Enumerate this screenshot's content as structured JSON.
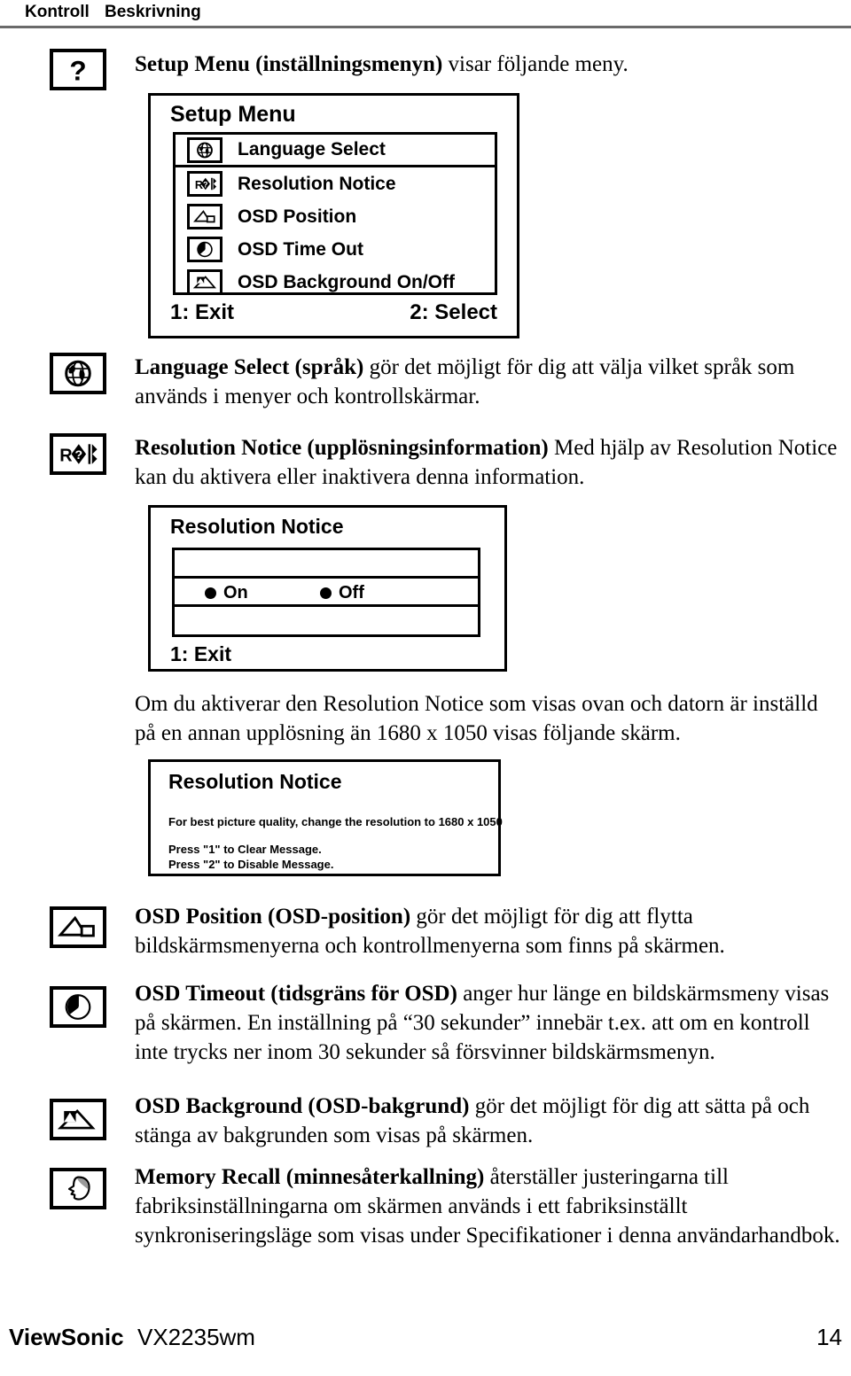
{
  "header": {
    "col1": "Kontroll",
    "col2": "Beskrivning"
  },
  "intro": {
    "text_bold": "Setup Menu (inställningsmenyn)",
    "text_rest": " visar följande meny."
  },
  "osd_setup": {
    "title": "Setup Menu",
    "items": [
      {
        "icon": "globe-icon",
        "label": "Language Select"
      },
      {
        "icon": "resolution-icon",
        "label": "Resolution Notice"
      },
      {
        "icon": "osd-position-icon",
        "label": "OSD Position"
      },
      {
        "icon": "osd-timeout-icon",
        "label": "OSD Time Out"
      },
      {
        "icon": "osd-background-icon",
        "label": "OSD Background On/Off"
      }
    ],
    "footer_left": "1: Exit",
    "footer_right": "2: Select"
  },
  "osd_resolution_notice": {
    "title": "Resolution Notice",
    "option_on": "On",
    "option_off": "Off",
    "footer_left": "1: Exit"
  },
  "osd_resolution_message": {
    "title": "Resolution Notice",
    "line1": "For best picture quality, change the resolution to 1680 x 1050",
    "line2": "Press \"1\" to Clear Message.",
    "line3": "Press \"2\" to Disable Message."
  },
  "paragraphs": {
    "language_select": {
      "bold": "Language Select (språk)",
      "rest": " gör det möjligt för dig att välja vilket språk som används i menyer och kontrollskärmar."
    },
    "resolution_notice": {
      "bold": "Resolution Notice (upplösningsinformation)",
      "rest": " Med hjälp av Resolution Notice kan du aktivera eller inaktivera denna information."
    },
    "resolution_explain": {
      "text": "Om du aktiverar den Resolution Notice som visas ovan och datorn är inställd på en annan upplösning än 1680 x 1050 visas följande skärm."
    },
    "osd_position": {
      "bold": "OSD Position (OSD-position)",
      "rest": " gör det möjligt för dig att flytta bildskärmsmenyerna och kontrollmenyerna som finns på skärmen."
    },
    "osd_timeout": {
      "bold": "OSD Timeout (tidsgräns för OSD)",
      "rest": " anger hur länge en bildskärmsmeny visas på skärmen. En inställning på “30 sekunder” innebär t.ex. att om en kontroll inte trycks ner inom 30 sekunder så försvinner bildskärmsmenyn."
    },
    "osd_background": {
      "bold": "OSD Background (OSD-bakgrund)",
      "rest": " gör det möjligt för dig att sätta på och stänga av bakgrunden som visas på skärmen."
    },
    "memory_recall": {
      "bold": "Memory Recall (minnesåterkallning)",
      "rest": " återställer justeringarna till fabriksinställningarna om skärmen används i ett fabriksinställt synkroniseringsläge som visas under Specifikationer i denna användarhandbok."
    }
  },
  "margin_icons": [
    "question-icon",
    "globe-icon",
    "resolution-icon",
    "osd-position-icon",
    "osd-timeout-icon",
    "osd-background-icon",
    "memory-recall-icon"
  ],
  "footer": {
    "brand": "ViewSonic",
    "model": "VX2235wm",
    "page": "14"
  }
}
